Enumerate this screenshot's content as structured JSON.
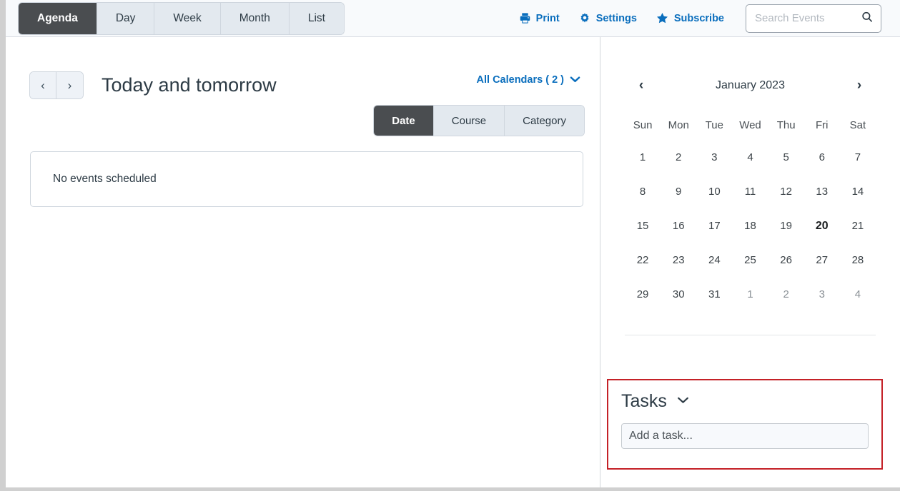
{
  "header": {
    "tabs": [
      {
        "label": "Agenda",
        "active": true
      },
      {
        "label": "Day",
        "active": false
      },
      {
        "label": "Week",
        "active": false
      },
      {
        "label": "Month",
        "active": false
      },
      {
        "label": "List",
        "active": false
      }
    ],
    "tools": [
      {
        "label": "Print",
        "icon": "printer-icon"
      },
      {
        "label": "Settings",
        "icon": "gear-icon"
      },
      {
        "label": "Subscribe",
        "icon": "star-icon"
      }
    ],
    "search": {
      "value": "",
      "placeholder": "Search Events",
      "icon": "search-icon"
    },
    "link_color": "#0a6ebd",
    "active_tab_bg": "#4a4d50"
  },
  "main": {
    "prev_label": "‹",
    "next_label": "›",
    "title": "Today and tomorrow",
    "calendars_link": "All Calendars ( 2 )",
    "group_tabs": [
      {
        "label": "Date",
        "active": true
      },
      {
        "label": "Course",
        "active": false
      },
      {
        "label": "Category",
        "active": false
      }
    ],
    "empty_message": "No events scheduled"
  },
  "sidebar": {
    "mini_calendar": {
      "prev_label": "‹",
      "next_label": "›",
      "title": "January 2023",
      "weekdays": [
        "Sun",
        "Mon",
        "Tue",
        "Wed",
        "Thu",
        "Fri",
        "Sat"
      ],
      "today": 20,
      "weeks": [
        [
          {
            "day": "1",
            "other": false
          },
          {
            "day": "2",
            "other": false
          },
          {
            "day": "3",
            "other": false
          },
          {
            "day": "4",
            "other": false
          },
          {
            "day": "5",
            "other": false
          },
          {
            "day": "6",
            "other": false
          },
          {
            "day": "7",
            "other": false
          }
        ],
        [
          {
            "day": "8",
            "other": false
          },
          {
            "day": "9",
            "other": false
          },
          {
            "day": "10",
            "other": false
          },
          {
            "day": "11",
            "other": false
          },
          {
            "day": "12",
            "other": false
          },
          {
            "day": "13",
            "other": false
          },
          {
            "day": "14",
            "other": false
          }
        ],
        [
          {
            "day": "15",
            "other": false
          },
          {
            "day": "16",
            "other": false
          },
          {
            "day": "17",
            "other": false
          },
          {
            "day": "18",
            "other": false
          },
          {
            "day": "19",
            "other": false
          },
          {
            "day": "20",
            "other": false,
            "today": true
          },
          {
            "day": "21",
            "other": false
          }
        ],
        [
          {
            "day": "22",
            "other": false
          },
          {
            "day": "23",
            "other": false
          },
          {
            "day": "24",
            "other": false
          },
          {
            "day": "25",
            "other": false
          },
          {
            "day": "26",
            "other": false
          },
          {
            "day": "27",
            "other": false
          },
          {
            "day": "28",
            "other": false
          }
        ],
        [
          {
            "day": "29",
            "other": false
          },
          {
            "day": "30",
            "other": false
          },
          {
            "day": "31",
            "other": false
          },
          {
            "day": "1",
            "other": true
          },
          {
            "day": "2",
            "other": true
          },
          {
            "day": "3",
            "other": true
          },
          {
            "day": "4",
            "other": true
          }
        ]
      ]
    },
    "tasks": {
      "title": "Tasks",
      "toggle_icon": "chevron-down-icon",
      "input_value": "",
      "input_placeholder": "Add a task...",
      "highlight_color": "#c42127"
    }
  }
}
